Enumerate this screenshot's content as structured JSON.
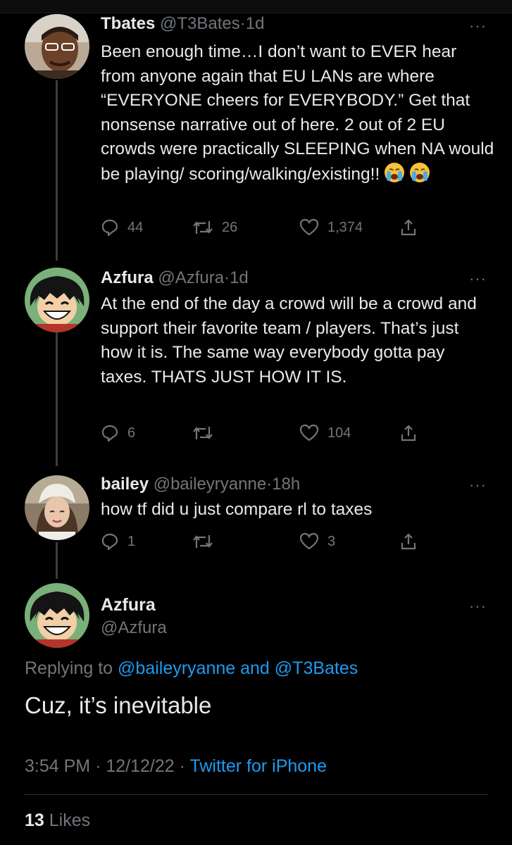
{
  "tweets": [
    {
      "name": "Tbates",
      "handle": "@T3Bates",
      "time": "1d",
      "text": "Been enough time…I don’t want to EVER hear from anyone again that EU LANs are where “EVERYONE cheers for EVERYBODY.” Get that nonsense narrative out of here. 2 out of 2 EU crowds were practically SLEEPING when NA would be playing/ scoring/walking/existing!!",
      "emoji": "loudly-crying-face x2",
      "replies": "44",
      "retweets": "26",
      "likes": "1,374"
    },
    {
      "name": "Azfura",
      "handle": "@Azfura",
      "time": "1d",
      "text": "At the end of the day a crowd will be a crowd and support their favorite team / players. That’s just how it is. The same way everybody gotta pay taxes. THATS JUST HOW IT IS.",
      "replies": "6",
      "retweets": "",
      "likes": "104"
    },
    {
      "name": "bailey",
      "handle": "@baileyryanne",
      "time": "18h",
      "text": "how tf did u just compare rl to taxes",
      "replies": "1",
      "retweets": "",
      "likes": "3"
    }
  ],
  "main": {
    "name": "Azfura",
    "handle": "@Azfura",
    "replying_prefix": "Replying to",
    "reply_to_1": "@baileyryanne",
    "reply_and": "and",
    "reply_to_2": "@T3Bates",
    "text": "Cuz, it’s inevitable",
    "time": "3:54 PM",
    "date": "12/12/22",
    "source": "Twitter for iPhone",
    "likes_count": "13",
    "likes_label": "Likes"
  },
  "ui": {
    "sep": "·",
    "more": "···"
  },
  "colors": {
    "background": "#000000",
    "link": "#1d9bf0",
    "secondary": "#71767b",
    "thread_line": "#3a3d40"
  }
}
